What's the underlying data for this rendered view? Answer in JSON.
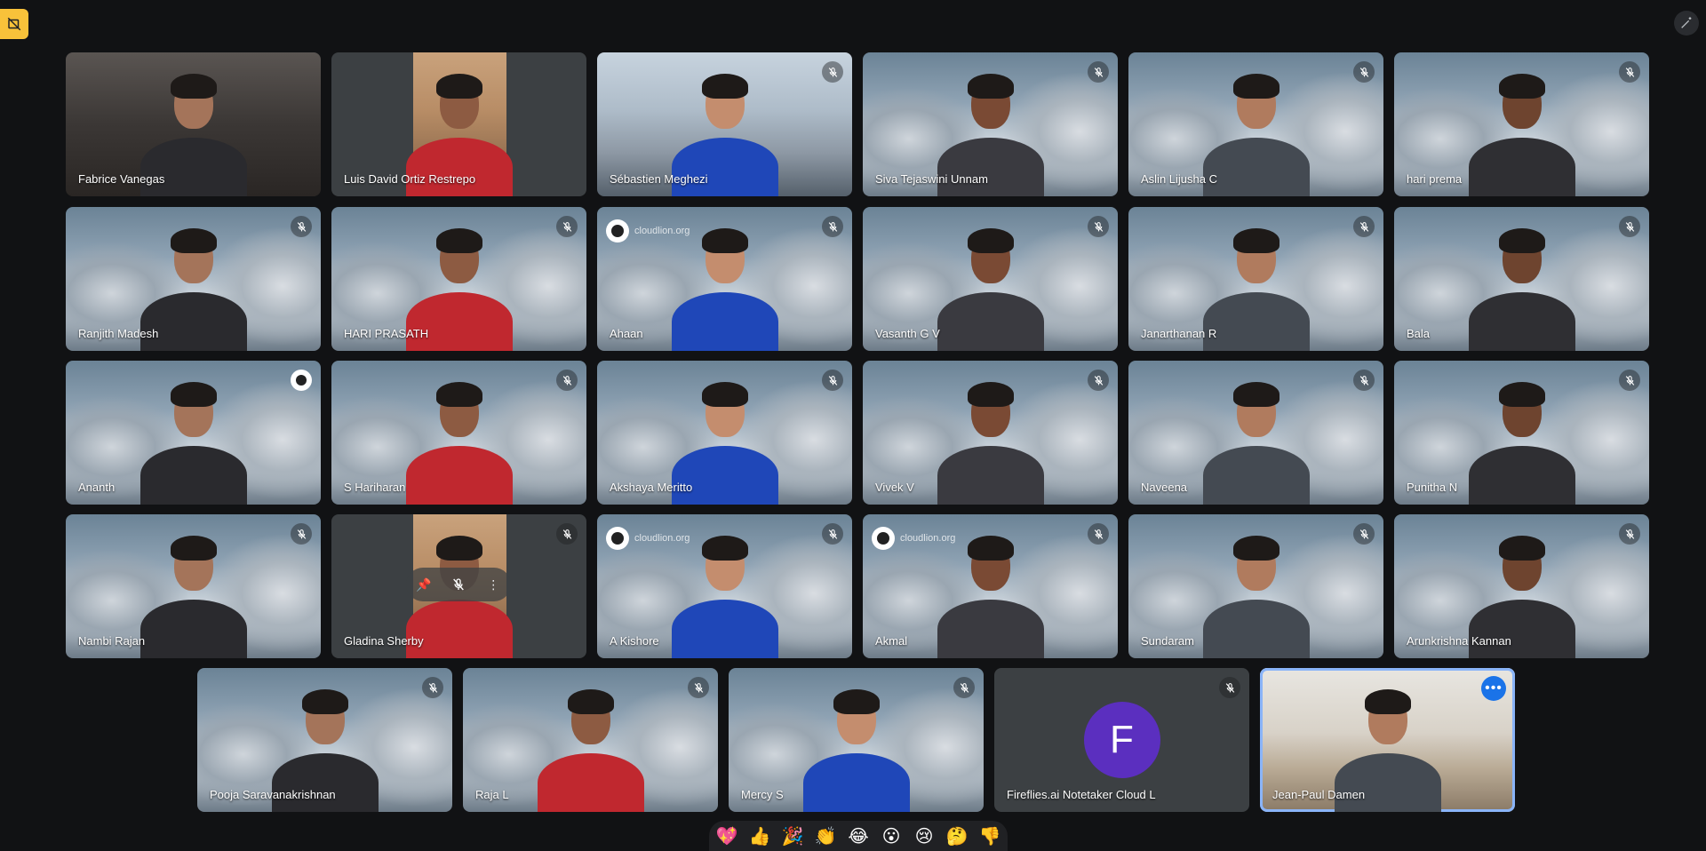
{
  "participants_rows": [
    [
      {
        "name": "Fabrice Vanegas",
        "style": "cam",
        "muted": false
      },
      {
        "name": "Luis David Ortiz Restrepo",
        "style": "flat",
        "muted": false
      },
      {
        "name": "Sébastien Meghezi",
        "style": "cam2",
        "muted": true
      },
      {
        "name": "Siva Tejaswini Unnam",
        "style": "sky",
        "muted": true
      },
      {
        "name": "Aslin Lijusha C",
        "style": "sky",
        "muted": true
      },
      {
        "name": "hari prema",
        "style": "sky",
        "muted": true
      }
    ],
    [
      {
        "name": "Ranjith Madesh",
        "style": "sky",
        "muted": true
      },
      {
        "name": "HARI PRASATH",
        "style": "sky",
        "muted": true
      },
      {
        "name": "Ahaan",
        "style": "sky",
        "muted": true,
        "watermark": "cloudlion.org"
      },
      {
        "name": "Vasanth G V",
        "style": "sky",
        "muted": true
      },
      {
        "name": "Janarthanan R",
        "style": "sky",
        "muted": true
      },
      {
        "name": "Bala",
        "style": "sky",
        "muted": true
      }
    ],
    [
      {
        "name": "Ananth",
        "style": "sky",
        "muted": false,
        "avatar_badge": true
      },
      {
        "name": "S Hariharan",
        "style": "sky",
        "muted": true
      },
      {
        "name": "Akshaya Meritto",
        "style": "sky",
        "muted": true
      },
      {
        "name": "Vivek V",
        "style": "sky",
        "muted": true
      },
      {
        "name": "Naveena",
        "style": "sky",
        "muted": true
      },
      {
        "name": "Punitha N",
        "style": "sky",
        "muted": true
      }
    ],
    [
      {
        "name": "Nambi Rajan",
        "style": "sky",
        "muted": true
      },
      {
        "name": "Gladina Sherby",
        "style": "flat",
        "muted": true,
        "hover_controls": true
      },
      {
        "name": "A Kishore",
        "style": "sky",
        "muted": true,
        "watermark": "cloudlion.org"
      },
      {
        "name": "Akmal",
        "style": "sky",
        "muted": true,
        "watermark": "cloudlion.org"
      },
      {
        "name": "Sundaram",
        "style": "sky",
        "muted": true
      },
      {
        "name": "Arunkrishna Kannan",
        "style": "sky",
        "muted": true
      }
    ],
    [
      {
        "name": "Pooja Saravanakrishnan",
        "style": "sky",
        "muted": true
      },
      {
        "name": "Raja L",
        "style": "sky",
        "muted": true
      },
      {
        "name": "Mercy S",
        "style": "sky",
        "muted": true
      },
      {
        "name": "Fireflies.ai Notetaker Cloud L",
        "style": "letter",
        "muted": true,
        "letter": "F"
      },
      {
        "name": "Jean-Paul Damen",
        "style": "room",
        "muted": false,
        "active": true,
        "more_label": "•••"
      }
    ]
  ],
  "reactions": [
    {
      "id": "sparkling-heart",
      "glyph": "💖"
    },
    {
      "id": "thumbs-up",
      "glyph": "👍"
    },
    {
      "id": "party-popper",
      "glyph": "🎉"
    },
    {
      "id": "clapping-hands",
      "glyph": "👏"
    },
    {
      "id": "tears-of-joy",
      "glyph": "😂"
    },
    {
      "id": "surprised",
      "glyph": "😮"
    },
    {
      "id": "sad",
      "glyph": "😢"
    },
    {
      "id": "thinking",
      "glyph": "🤔"
    },
    {
      "id": "thumbs-down",
      "glyph": "👎"
    }
  ],
  "colors": {
    "background": "#111214",
    "corner_button": "#f8c23a",
    "active_outline": "#8ab4f8",
    "avatar_purple": "#5b2fbf",
    "more_button": "#1a73e8"
  },
  "icons": {
    "corner": "hide-self-view-icon",
    "top_right": "magic-wand-icon",
    "mute": "mic-off-icon"
  }
}
